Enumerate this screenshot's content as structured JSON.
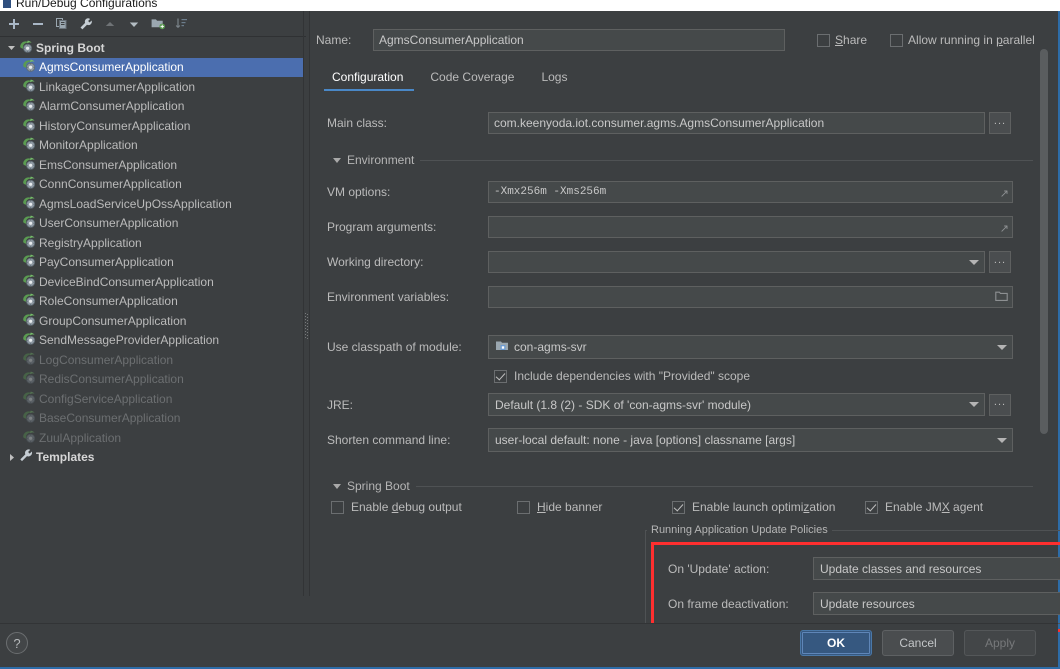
{
  "window": {
    "title": "Run/Debug Configurations",
    "icon": "idea-window-icon"
  },
  "toolbar": {
    "buttons": [
      {
        "name": "add-configuration-button",
        "icon": "plus-icon",
        "tooltip": "Add New Configuration"
      },
      {
        "name": "remove-configuration-button",
        "icon": "minus-icon",
        "tooltip": "Remove Configuration"
      },
      {
        "name": "copy-configuration-button",
        "icon": "copy-icon",
        "tooltip": "Copy Configuration"
      },
      {
        "name": "edit-templates-button",
        "icon": "wrench-icon",
        "tooltip": "Edit Templates"
      },
      {
        "name": "move-up-button",
        "icon": "arrow-up-icon",
        "tooltip": "Move Up"
      },
      {
        "name": "move-down-button",
        "icon": "arrow-down-icon",
        "tooltip": "Move Down"
      },
      {
        "name": "move-into-folder-button",
        "icon": "folder-move-icon",
        "tooltip": "Move into new folder"
      },
      {
        "name": "sort-configurations-button",
        "icon": "sort-icon",
        "tooltip": "Sort Configurations"
      }
    ]
  },
  "sidebar": {
    "groups": [
      {
        "label": "Spring Boot",
        "expanded": true,
        "icon": "spring-boot-icon",
        "items": [
          {
            "label": "AgmsConsumerApplication",
            "selected": true,
            "dim": false
          },
          {
            "label": "LinkageConsumerApplication",
            "selected": false,
            "dim": false
          },
          {
            "label": "AlarmConsumerApplication",
            "selected": false,
            "dim": false
          },
          {
            "label": "HistoryConsumerApplication",
            "selected": false,
            "dim": false
          },
          {
            "label": "MonitorApplication",
            "selected": false,
            "dim": false
          },
          {
            "label": "EmsConsumerApplication",
            "selected": false,
            "dim": false
          },
          {
            "label": "ConnConsumerApplication",
            "selected": false,
            "dim": false
          },
          {
            "label": "AgmsLoadServiceUpOssApplication",
            "selected": false,
            "dim": false
          },
          {
            "label": "UserConsumerApplication",
            "selected": false,
            "dim": false
          },
          {
            "label": "RegistryApplication",
            "selected": false,
            "dim": false
          },
          {
            "label": "PayConsumerApplication",
            "selected": false,
            "dim": false
          },
          {
            "label": "DeviceBindConsumerApplication",
            "selected": false,
            "dim": false
          },
          {
            "label": "RoleConsumerApplication",
            "selected": false,
            "dim": false
          },
          {
            "label": "GroupConsumerApplication",
            "selected": false,
            "dim": false
          },
          {
            "label": "SendMessageProviderApplication",
            "selected": false,
            "dim": false
          },
          {
            "label": "LogConsumerApplication",
            "selected": false,
            "dim": true
          },
          {
            "label": "RedisConsumerApplication",
            "selected": false,
            "dim": true
          },
          {
            "label": "ConfigServiceApplication",
            "selected": false,
            "dim": true
          },
          {
            "label": "BaseConsumerApplication",
            "selected": false,
            "dim": true
          },
          {
            "label": "ZuulApplication",
            "selected": false,
            "dim": true
          }
        ]
      }
    ],
    "templates": {
      "label": "Templates",
      "expanded": false,
      "icon": "wrench-icon"
    }
  },
  "header": {
    "name_label": "Name:",
    "name_value": "AgmsConsumerApplication",
    "share_label": "Share",
    "share_underline": "S",
    "share_checked": false,
    "parallel_label": "Allow running in parallel",
    "parallel_underline": "p",
    "parallel_checked": false
  },
  "tabs": [
    {
      "label": "Configuration",
      "active": true
    },
    {
      "label": "Code Coverage",
      "active": false
    },
    {
      "label": "Logs",
      "active": false
    }
  ],
  "form": {
    "main_class_label": "Main class:",
    "main_class_value": "com.keenyoda.iot.consumer.agms.AgmsConsumerApplication",
    "browse_label": "...",
    "environment_section": "Environment",
    "vm_options_label": "VM options:",
    "vm_options_value": "-Xmx256m -Xms256m",
    "program_arguments_label": "Program arguments:",
    "program_arguments_value": "",
    "working_directory_label": "Working directory:",
    "working_directory_value": "",
    "environment_variables_label": "Environment variables:",
    "environment_variables_value": "",
    "classpath_label": "Use classpath of module:",
    "classpath_value": "con-agms-svr",
    "include_provided_label": "Include dependencies with \"Provided\" scope",
    "include_provided_checked": true,
    "jre_label": "JRE:",
    "jre_value": "Default (1.8 (2) - SDK of 'con-agms-svr' module)",
    "shorten_label": "Shorten command line:",
    "shorten_value": "user-local default: none - java [options] classname [args]",
    "spring_boot_section": "Spring Boot",
    "checkboxes": [
      {
        "label": "Enable debug output",
        "underline": "d",
        "checked": false,
        "name": "enable-debug-output-checkbox"
      },
      {
        "label": "Hide banner",
        "underline": "H",
        "checked": false,
        "name": "hide-banner-checkbox"
      },
      {
        "label": "Enable launch optimization",
        "underline": "z",
        "checked": true,
        "name": "enable-launch-optimization-checkbox"
      },
      {
        "label": "Enable JMX agent",
        "underline": "X",
        "checked": true,
        "name": "enable-jmx-agent-checkbox"
      }
    ],
    "policies_legend": "Running Application Update Policies",
    "on_update_label": "On 'Update' action:",
    "on_update_value": "Update classes and resources",
    "on_frame_label": "On frame deactivation:",
    "on_frame_value": "Update resources",
    "help_glyph": "?"
  },
  "footer": {
    "help_glyph": "?",
    "ok_label": "OK",
    "cancel_label": "Cancel",
    "apply_label": "Apply",
    "apply_enabled": false
  },
  "colors": {
    "background": "#3c3f41",
    "selection": "#4b6eaf",
    "accent": "#4a88c7",
    "highlight_box": "#ff2f2f",
    "ok_button": "#365880",
    "dialog_border": "#2d6ca8"
  }
}
